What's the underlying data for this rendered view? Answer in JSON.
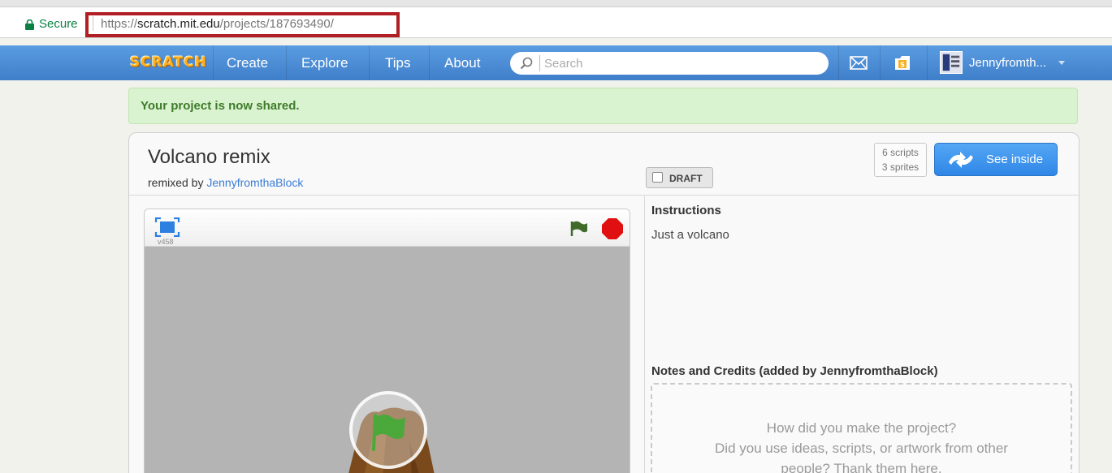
{
  "browser": {
    "secure_label": "Secure",
    "url_scheme": "https://",
    "url_host": "scratch.mit.edu",
    "url_path": "/projects/187693490/",
    "highlight_color": "#b11e24"
  },
  "nav": {
    "logo_text": "SCRATCH",
    "items": [
      {
        "label": "Create"
      },
      {
        "label": "Explore"
      },
      {
        "label": "Tips"
      },
      {
        "label": "About"
      }
    ],
    "search_placeholder": "Search",
    "username": "Jennyfromth...",
    "icons": [
      "mail-icon",
      "mystuff-icon",
      "avatar"
    ],
    "color": "#4a8fd9"
  },
  "banner": {
    "text": "Your project is now shared.",
    "color": "#d9f2cf"
  },
  "project": {
    "title": "Volcano remix",
    "remixed_prefix": "remixed by",
    "author": "JennyfromthaBlock",
    "draft_label": "DRAFT",
    "scripts_count": "6 scripts",
    "sprites_count": "3 sprites",
    "see_inside_label": "See inside",
    "version": "v458"
  },
  "details": {
    "instructions_heading": "Instructions",
    "instructions_text": "Just a volcano",
    "notes_heading": "Notes and Credits (added by JennyfromthaBlock)",
    "notes_placeholder_line1": "How did you make the project?",
    "notes_placeholder_line2": "Did you use ideas, scripts, or artwork from other",
    "notes_placeholder_line3": "people? Thank them here."
  }
}
